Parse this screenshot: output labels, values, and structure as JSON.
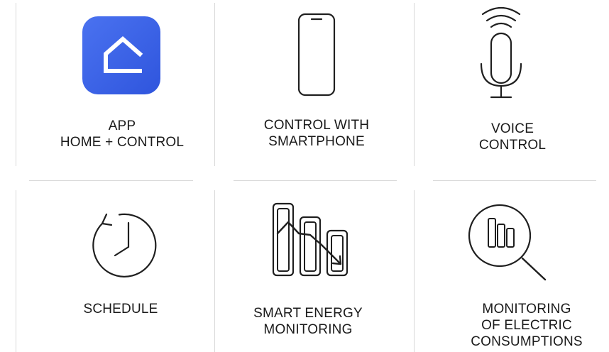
{
  "features": [
    {
      "icon": "home-app-icon",
      "lines": [
        "APP",
        "HOME + CONTROL"
      ],
      "accent": "#3d63e8"
    },
    {
      "icon": "smartphone-icon",
      "lines": [
        "CONTROL WITH",
        "SMARTPHONE"
      ]
    },
    {
      "icon": "microphone-icon",
      "lines": [
        "VOICE",
        "CONTROL"
      ]
    },
    {
      "icon": "clock-icon",
      "lines": [
        "SCHEDULE"
      ]
    },
    {
      "icon": "energy-chart-icon",
      "lines": [
        "SMART ENERGY",
        "MONITORING"
      ]
    },
    {
      "icon": "magnifier-chart-icon",
      "lines": [
        "MONITORING",
        "OF ELECTRIC",
        "CONSUMPTIONS"
      ]
    }
  ]
}
